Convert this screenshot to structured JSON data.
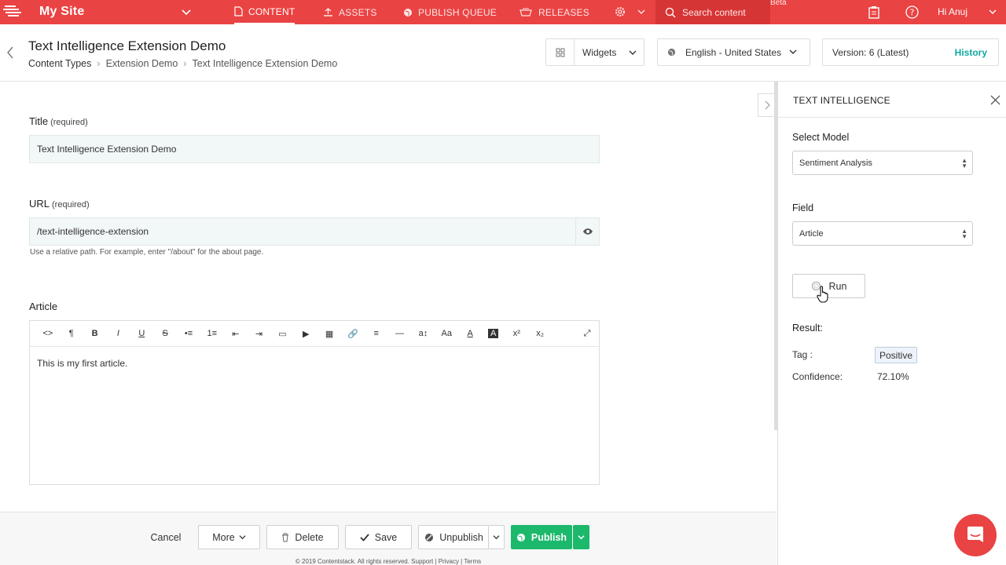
{
  "topbar": {
    "site_name": "My Site",
    "nav": [
      {
        "label": "CONTENT",
        "icon": "document-icon"
      },
      {
        "label": "ASSETS",
        "icon": "upload-icon"
      },
      {
        "label": "PUBLISH QUEUE",
        "icon": "globe-icon"
      },
      {
        "label": "RELEASES",
        "icon": "releases-icon"
      }
    ],
    "search_placeholder": "Search content",
    "beta": "Beta",
    "greeting": "Hi  Anuj",
    "accent_color": "#ea4343"
  },
  "header": {
    "entry_title": "Text Intelligence Extension Demo",
    "breadcrumbs": [
      "Content Types",
      "Extension Demo",
      "Text Intelligence Extension Demo"
    ],
    "widgets_label": "Widgets",
    "locale": "English - United States",
    "version": "Version: 6 (Latest)",
    "history": "History"
  },
  "form": {
    "title_label": "Title",
    "title_required": "(required)",
    "title_value": "Text Intelligence Extension Demo",
    "url_label": "URL",
    "url_required": "(required)",
    "url_value": "/text-intelligence-extension",
    "url_hint": "Use a relative path. For example, enter \"/about\" for the about page.",
    "article_label": "Article",
    "article_body": "This is my first article.",
    "toolbar": [
      "<>",
      "¶",
      "B",
      "I",
      "U",
      "S",
      "•≡",
      "1≡",
      "⇤",
      "⇥",
      "▭",
      "▶",
      "▦",
      "🔗",
      "≡",
      "—",
      "a↕",
      "Aa",
      "A",
      "A",
      "x²",
      "x₂"
    ]
  },
  "footer": {
    "cancel": "Cancel",
    "more": "More",
    "delete": "Delete",
    "save": "Save",
    "unpublish": "Unpublish",
    "publish": "Publish",
    "copyright": "© 2019 Contentstack. All rights reserved. Support | Privacy | Terms"
  },
  "panel": {
    "title": "TEXT INTELLIGENCE",
    "model_label": "Select Model",
    "model_value": "Sentiment Analysis",
    "field_label": "Field",
    "field_value": "Article",
    "run": "Run",
    "result_label": "Result:",
    "tag_label": "Tag :",
    "tag_value": "Positive",
    "confidence_label": "Confidence:",
    "confidence_value": "72.10%"
  }
}
